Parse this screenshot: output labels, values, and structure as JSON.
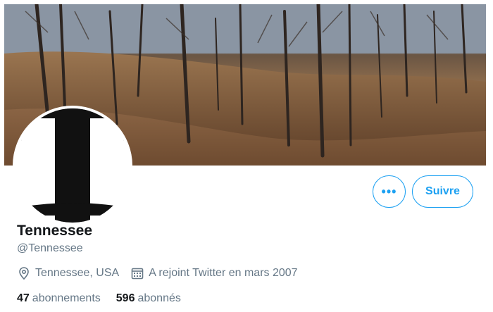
{
  "profile": {
    "name": "Tennessee",
    "handle": "@Tennessee",
    "location": "Tennessee, USA",
    "joined": "A rejoint Twitter en mars 2007"
  },
  "actions": {
    "more_label": "•••",
    "follow_label": "Suivre"
  },
  "stats": {
    "following_count": "47",
    "following_label": "abonnements",
    "followers_count": "596",
    "followers_label": "abonnés"
  },
  "icons": {
    "location": "location-pin-icon",
    "joined": "calendar-icon",
    "more": "more-options-icon"
  },
  "colors": {
    "accent": "#1da1f2",
    "text_primary": "#14171a",
    "text_secondary": "#657786"
  }
}
